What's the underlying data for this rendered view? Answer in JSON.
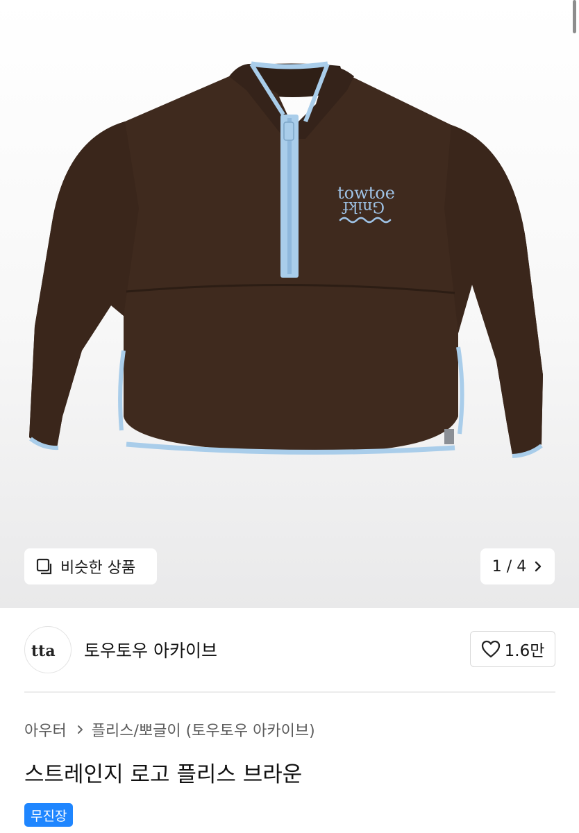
{
  "gallery": {
    "similar_label": "비슷한 상품",
    "page_indicator": "1 / 4"
  },
  "shop": {
    "avatar_text": "tta",
    "name": "토우토우 아카이브",
    "like_count": "1.6만"
  },
  "product": {
    "breadcrumb": [
      "아우터",
      "플리스/뽀글이 (토우토우 아카이브)"
    ],
    "title": "스트레인지 로고 플리스 브라운",
    "badge": "무진장",
    "logo_text_top": "towtoe",
    "logo_text_bottom": "Gnikf"
  },
  "colors": {
    "garment": "#3f2a1e",
    "trim": "#a9cdea",
    "badge": "#1f86ff"
  }
}
